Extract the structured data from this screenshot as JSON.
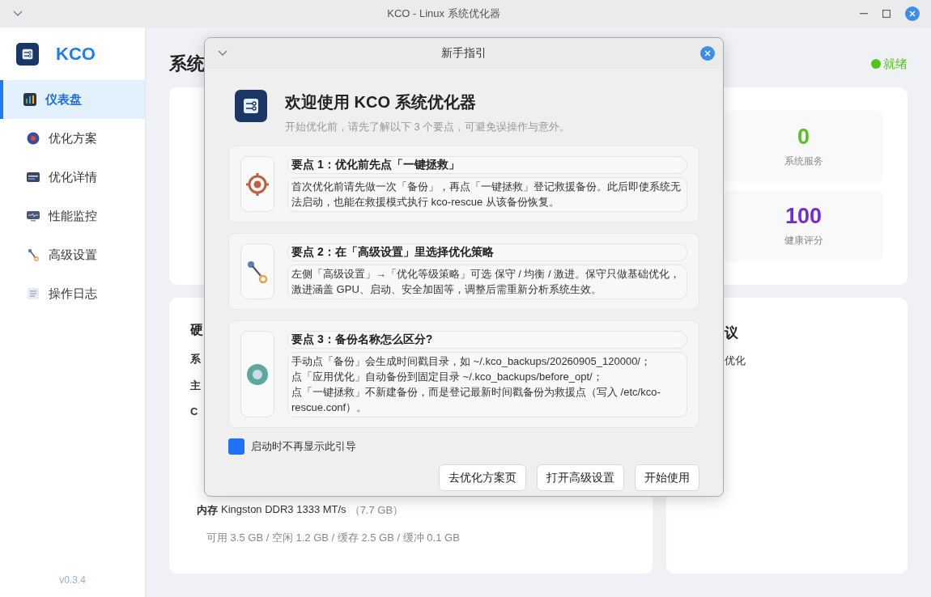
{
  "window": {
    "title": "KCO - Linux 系统优化器"
  },
  "sidebar": {
    "app_name": "KCO",
    "items": [
      {
        "label": "仪表盘",
        "selected": true
      },
      {
        "label": "优化方案",
        "selected": false
      },
      {
        "label": "优化详情",
        "selected": false
      },
      {
        "label": "性能监控",
        "selected": false
      },
      {
        "label": "高级设置",
        "selected": false
      },
      {
        "label": "操作日志",
        "selected": false
      }
    ],
    "version": "v0.3.4"
  },
  "main": {
    "title": "系统",
    "status": "就绪",
    "stats": [
      {
        "value": "0",
        "label": "系统服务",
        "color": "#52c41a"
      },
      {
        "value": "100",
        "label": "健康评分",
        "color": "#722ed1"
      }
    ],
    "hardware_card": {
      "title": "硬",
      "rows": [
        "系",
        "主",
        "C"
      ],
      "memory_label": "内存",
      "memory_value": "Kingston DDR3 1333 MT/s",
      "memory_size": "（7.7 GB）",
      "memory_detail": "可用 3.5 GB / 空闲 1.2 GB / 缓存 2.5 GB / 缓冲 0.1 GB"
    },
    "advice_card": {
      "title": "议",
      "text": "优化"
    }
  },
  "dialog": {
    "title": "新手指引",
    "heading": "欢迎使用 KCO 系统优化器",
    "subtitle": "开始优化前，请先了解以下 3 个要点，可避免误操作与意外。",
    "tips": [
      {
        "title": "要点 1：优化前先点「一键拯救」",
        "lines": [
          "首次优化前请先做一次「备份」，再点「一键拯救」登记救援备份。此后即使系统无法启动，也能在救援模式执行 kco-rescue 从该备份恢复。"
        ]
      },
      {
        "title": "要点 2：在「高级设置」里选择优化策略",
        "lines": [
          "左侧「高级设置」→「优化等级策略」可选 保守 / 均衡 / 激进。保守只做基础优化，激进涵盖 GPU、启动、安全加固等，调整后需重新分析系统生效。"
        ]
      },
      {
        "title": "要点 3：备份名称怎么区分?",
        "lines": [
          "手动点「备份」会生成时间戳目录，如 ~/.kco_backups/20260905_120000/；",
          "点「应用优化」自动备份到固定目录 ~/.kco_backups/before_opt/；",
          "点「一键拯救」不新建备份，而是登记最新时间戳备份为救援点（写入 /etc/kco-rescue.conf）。"
        ]
      }
    ],
    "dont_show": {
      "label": "启动时不再显示此引导",
      "checked": true
    },
    "buttons": [
      "去优化方案页",
      "打开高级设置",
      "开始使用"
    ]
  }
}
